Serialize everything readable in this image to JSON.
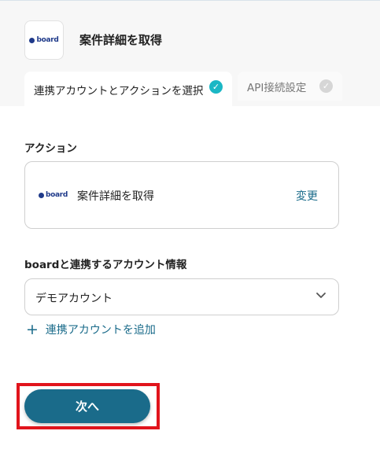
{
  "header": {
    "app_logo_text": "board",
    "title": "案件詳細を取得"
  },
  "tabs": [
    {
      "label": "連携アカウントとアクションを選択",
      "state": "active"
    },
    {
      "label": "API接続設定",
      "state": "inactive"
    }
  ],
  "action_section": {
    "label": "アクション",
    "app_logo_text": "board",
    "action_name": "案件詳細を取得",
    "change_label": "変更"
  },
  "account_section": {
    "label": "boardと連携するアカウント情報",
    "selected_value": "デモアカウント",
    "add_account_label": "連携アカウントを追加"
  },
  "footer": {
    "next_label": "次へ"
  },
  "colors": {
    "accent": "#1a6b8a",
    "check_active": "#1bb7c5",
    "highlight": "#e1141c"
  }
}
